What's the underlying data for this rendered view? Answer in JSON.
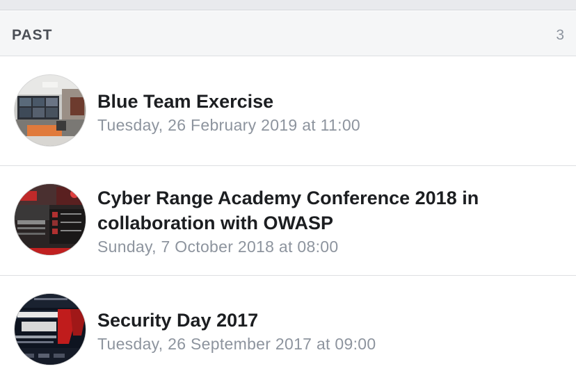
{
  "section": {
    "title": "PAST",
    "count": "3"
  },
  "events": [
    {
      "title": "Blue Team Exercise",
      "date": "Tuesday, 26 February 2019 at 11:00",
      "thumbnail_icon": "classroom-photo"
    },
    {
      "title": "Cyber Range Academy Conference 2018 in collaboration with OWASP",
      "date": "Sunday, 7 October 2018 at 08:00",
      "thumbnail_icon": "conference-poster"
    },
    {
      "title": "Security Day 2017",
      "date": "Tuesday, 26 September 2017 at 09:00",
      "thumbnail_icon": "security-day-poster"
    }
  ],
  "colors": {
    "title": "#1c1e21",
    "secondary": "#8d949e",
    "header_bg": "#f5f6f7",
    "divider": "#dddfe2"
  }
}
